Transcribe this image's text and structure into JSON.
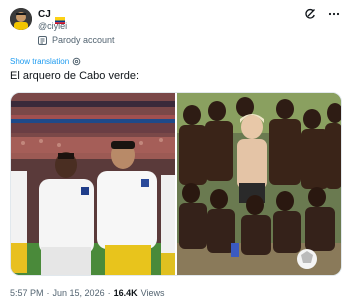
{
  "author": {
    "display_name": "CJ",
    "handle": "@ciylei",
    "parody_label": "Parody account",
    "avatar_icon": "avatar-photo-icon",
    "flag_icon": "colombia-flag-icon"
  },
  "header_actions": {
    "grok_icon": "grok-icon",
    "more_icon": "more-icon"
  },
  "translate": {
    "label": "Show translation",
    "icon": "settings-gear-icon"
  },
  "tweet": {
    "text": "El arquero de Cabo verde:"
  },
  "media": {
    "left_photo": "football-team-lineup-photo",
    "right_photo": "group-of-boys-photo"
  },
  "meta": {
    "time": "5:57 PM",
    "separator": "·",
    "date": "Jun 15, 2026",
    "views_count": "16.4K",
    "views_label": "Views"
  },
  "colors": {
    "link": "#1d9bf0",
    "secondary_text": "#536471",
    "primary_text": "#0f1419"
  }
}
